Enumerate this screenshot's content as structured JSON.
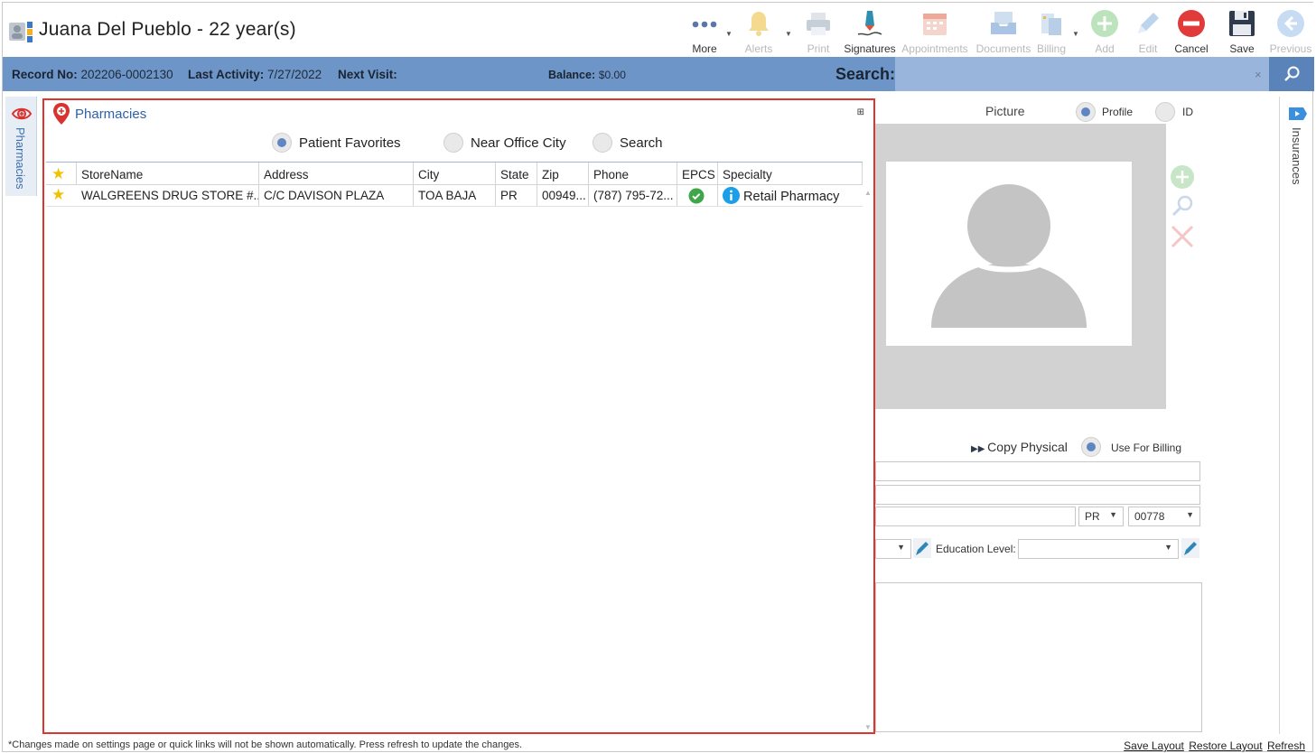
{
  "window": {
    "title": "Juana Del Pueblo - 22 year(s)"
  },
  "toolbar": {
    "more": "More",
    "alerts": "Alerts",
    "print": "Print",
    "signatures": "Signatures",
    "appointments": "Appointments",
    "documents": "Documents",
    "billing": "Billing",
    "add": "Add",
    "edit": "Edit",
    "cancel": "Cancel",
    "save": "Save",
    "previous": "Previous"
  },
  "infobar": {
    "record_label": "Record No:",
    "record_value": "202206-0002130",
    "activity_label": "Last Activity:",
    "activity_value": "7/27/2022",
    "next_visit_label": "Next Visit:",
    "next_visit_value": "",
    "balance_label": "Balance:",
    "balance_value": "$0.00",
    "search_label": "Search:",
    "search_value": "",
    "clear_glyph": "×"
  },
  "side_tabs": {
    "left": "Pharmacies",
    "right": "Insurances"
  },
  "pharmacies": {
    "title": "Pharmacies",
    "pin_glyph": "⊞",
    "options": [
      {
        "label": "Patient Favorites",
        "selected": true
      },
      {
        "label": "Near Office City",
        "selected": false
      },
      {
        "label": "Search",
        "selected": false
      }
    ],
    "columns": [
      "StoreName",
      "Address",
      "City",
      "State",
      "Zip",
      "Phone",
      "EPCS",
      "Specialty"
    ],
    "rows": [
      {
        "favorite": true,
        "store_name": "WALGREENS DRUG STORE #...",
        "address": "C/C DAVISON PLAZA",
        "city": "TOA BAJA",
        "state": "PR",
        "zip": "00949...",
        "phone": "(787) 795-72...",
        "epcs": true,
        "specialty": "Retail Pharmacy"
      }
    ]
  },
  "patient_panel": {
    "picture_label": "Picture",
    "profile_label": "Profile",
    "id_label": "ID",
    "copy_physical": "Copy Physical",
    "use_for_billing": "Use For Billing",
    "state_value": "PR",
    "zip_value": "00778",
    "education_label": "Education Level:",
    "education_value": ""
  },
  "footer": {
    "note": "*Changes made on settings page or quick links will not be shown automatically. Press refresh to update the changes.",
    "save_layout": "Save Layout",
    "restore_layout": "Restore Layout",
    "refresh": "Refresh"
  },
  "colors": {
    "accent": "#6d95c7",
    "highlight_border": "#e0342f",
    "link_blue": "#2e62aa",
    "favorite_star": "#f2c200",
    "epcs_green": "#3fa64a",
    "cancel_red": "#e03a3a"
  }
}
